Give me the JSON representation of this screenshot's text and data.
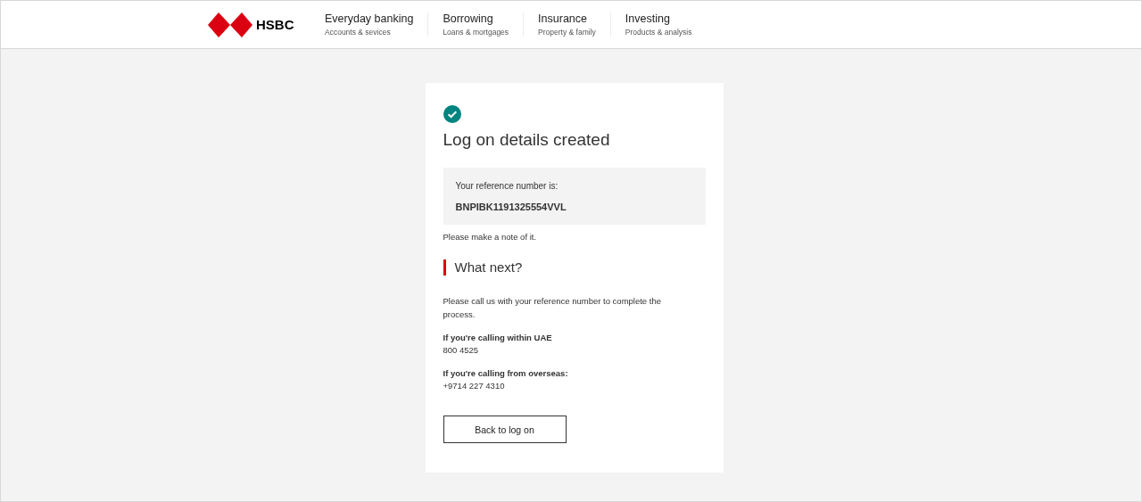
{
  "header": {
    "brand": "HSBC",
    "nav": [
      {
        "title": "Everyday banking",
        "subtitle": "Accounts & sevices"
      },
      {
        "title": "Borrowing",
        "subtitle": "Loans & mortgages"
      },
      {
        "title": "Insurance",
        "subtitle": "Property & family"
      },
      {
        "title": "Investing",
        "subtitle": "Products & analysis"
      }
    ]
  },
  "card": {
    "title": "Log on details created",
    "reference_label": "Your reference number is:",
    "reference_number": "BNPIBK1191325554VVL",
    "note": "Please make a note of it.",
    "next_heading": "What next?",
    "instructions": "Please call us with your reference number to complete the process.",
    "contacts": [
      {
        "label": "If you're calling within UAE",
        "number": "800 4525"
      },
      {
        "label": "If you're calling from overseas:",
        "number": "+9714 227 4310"
      }
    ],
    "button": "Back to log on"
  }
}
